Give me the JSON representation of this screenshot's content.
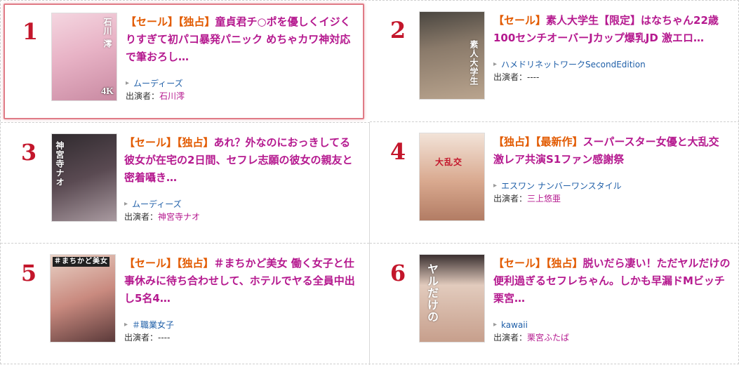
{
  "items": [
    {
      "rank": "1",
      "tags": [
        "【セール】",
        "【独占】"
      ],
      "title": "童貞君チ○ポを優しくイジくりすぎて初パコ暴発パニック めちゃカワ神対応で筆おろし…",
      "maker": "ムーディーズ",
      "cast_label": "出演者：",
      "cast": "石川澪",
      "thumb_badge": "4K",
      "thumb_vertical": "石川 澪",
      "thumb_color": "#e8b3c6"
    },
    {
      "rank": "2",
      "tags": [
        "【セール】"
      ],
      "title": "素人大学生【限定】はなちゃん22歳 100センチオーバーJカップ爆乳JD 激エロ…",
      "maker": "ハメドリネットワークSecondEdition",
      "cast_label": "出演者：",
      "cast": "----",
      "thumb_badge": "",
      "thumb_vertical": "素人大学生",
      "thumb_color": "#8a7a6a"
    },
    {
      "rank": "3",
      "tags": [
        "【セール】",
        "【独占】"
      ],
      "title": "あれ？外なのにおっきしてる 彼女が在宅の2日間、セフレ志願の彼女の親友と密着囁き…",
      "maker": "ムーディーズ",
      "cast_label": "出演者：",
      "cast": "神宮寺ナオ",
      "thumb_badge": "",
      "thumb_vertical": "神宮寺ナオ",
      "thumb_color": "#5a4a52"
    },
    {
      "rank": "4",
      "tags": [
        "【独占】",
        "【最新作】"
      ],
      "title": "スーパースター女優と大乱交 激レア共演S1ファン感謝祭",
      "maker": "エスワン ナンバーワンスタイル",
      "cast_label": "出演者：",
      "cast": "三上悠亜",
      "thumb_badge": "",
      "thumb_vertical": "大乱交",
      "thumb_color": "#d9a98f"
    },
    {
      "rank": "5",
      "tags": [
        "【セール】",
        "【独占】"
      ],
      "title": "＃まちかど美女 働く女子と仕事休みに待ち合わせして、ホテルでヤる全員中出し5名4…",
      "maker": "＃職業女子",
      "cast_label": "出演者：",
      "cast": "----",
      "thumb_badge": "",
      "thumb_vertical": "＃まちかど美女",
      "thumb_color": "#c98a7f"
    },
    {
      "rank": "6",
      "tags": [
        "【セール】",
        "【独占】"
      ],
      "title": "脱いだら凄い！ただヤルだけの便利過ぎるセフレちゃん。しかも早漏ドMビッチ 栗宮…",
      "maker": "kawaii",
      "cast_label": "出演者：",
      "cast": "栗宮ふたば",
      "thumb_badge": "",
      "thumb_vertical": "ヤルだけの",
      "thumb_color": "#e2cbbd"
    }
  ],
  "colors": {
    "rank": "#c3162b",
    "tag": "#e25a00",
    "title": "#b5198f",
    "maker": "#1f5fa8",
    "highlight_border": "#e07b86"
  },
  "icons": {
    "maker_arrow": "chevron-right-icon"
  }
}
